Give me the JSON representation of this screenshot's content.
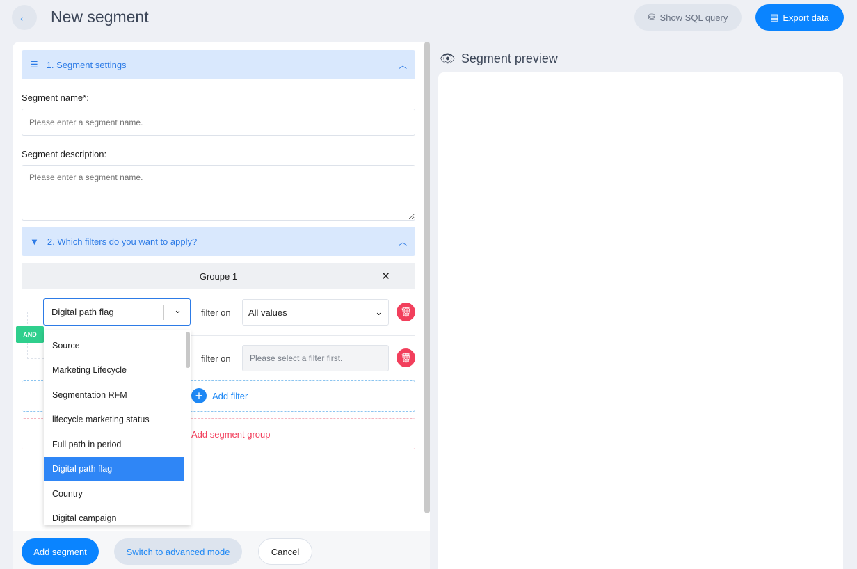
{
  "header": {
    "title": "New segment",
    "show_sql": "Show SQL query",
    "export": "Export data"
  },
  "settings": {
    "title": "1. Segment settings",
    "name_label": "Segment name*:",
    "name_placeholder": "Please enter a segment name.",
    "desc_label": "Segment description:",
    "desc_placeholder": "Please enter a segment name."
  },
  "filters": {
    "title": "2. Which filters do you want to apply?",
    "group": "Groupe 1",
    "and": "AND",
    "filter_on": "filter on",
    "row1": {
      "field": "Digital path flag",
      "value": "All values"
    },
    "row2": {
      "placeholder": "Please select a filter first."
    },
    "add_filter": "Add filter",
    "add_group": "Add segment group",
    "options": [
      "Source",
      "Marketing Lifecycle",
      "Segmentation RFM",
      "lifecycle marketing status",
      "Full path in period",
      "Digital path flag",
      "Country",
      "Digital campaign"
    ],
    "selected_option": "Digital path flag"
  },
  "footer": {
    "add": "Add segment",
    "advanced": "Switch to advanced mode",
    "cancel": "Cancel"
  },
  "preview": {
    "title": "Segment preview"
  },
  "colors": {
    "primary": "#0a84ff",
    "danger": "#f23f5c",
    "and": "#2fcf8d"
  }
}
